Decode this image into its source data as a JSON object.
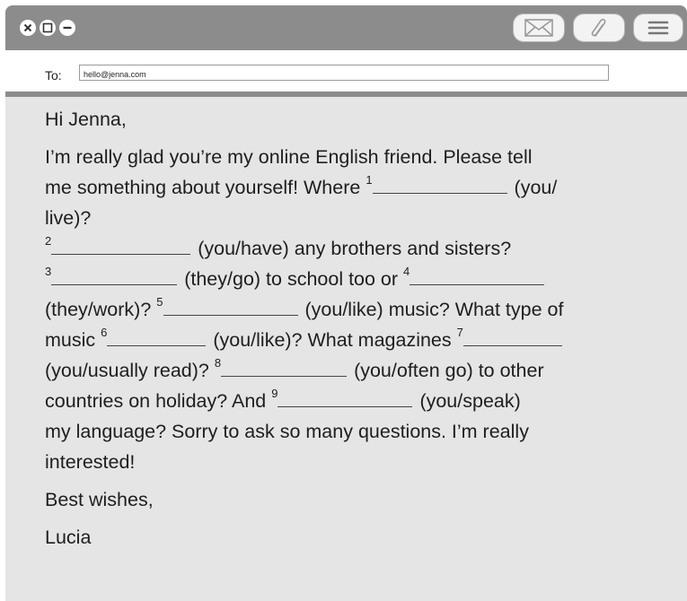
{
  "toolbar": {
    "icons": [
      "close-icon",
      "maximize-icon",
      "minimize-icon",
      "envelope-icon",
      "paperclip-icon",
      "menu-icon"
    ]
  },
  "to_field": {
    "label": "To:",
    "value": "hello@jenna.com"
  },
  "email": {
    "greeting": "Hi Jenna,",
    "l1": "I’m really glad you’re my online English friend. Please tell",
    "l2a": "me something about yourself! Where",
    "n1": "1",
    "l2b": "(you/",
    "l3": "live)?",
    "n2": "2",
    "l4": "(you/have) any brothers and sisters?",
    "n3": "3",
    "l5a": "(they/go) to school too or",
    "n4": "4",
    "l6a": "(they/work)?",
    "n5": "5",
    "l6b": "(you/like) music? What type of",
    "l7a": "music",
    "n6": "6",
    "l7b": "(you/like)? What magazines",
    "n7": "7",
    "l8a": "(you/usually read)?",
    "n8": "8",
    "l8b": "(you/often go) to other",
    "l9a": "countries on holiday? And",
    "n9": "9",
    "l9b": "(you/speak)",
    "l10": "my language? Sorry to ask so many questions. I’m really",
    "l11": "interested!",
    "closing": "Best wishes,",
    "signature": "Lucia"
  }
}
